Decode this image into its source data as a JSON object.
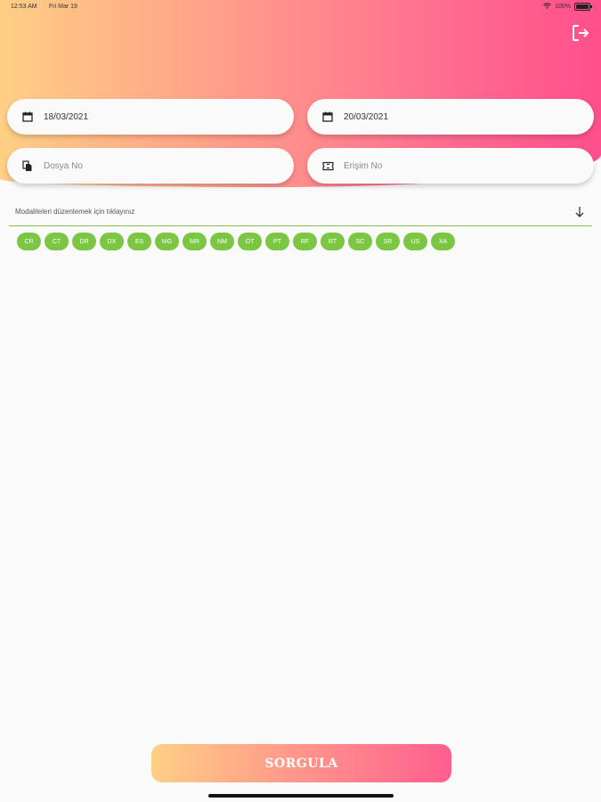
{
  "status_bar": {
    "time": "12:53 AM",
    "date": "Fri Mar 19",
    "battery": "100%"
  },
  "form": {
    "start_date": "18/03/2021",
    "end_date": "20/03/2021",
    "dosya_placeholder": "Dosya No",
    "erisim_placeholder": "Erişim No"
  },
  "modality_select": {
    "label": "Modaliteleri düzenlemek için tıklayınız"
  },
  "modalities": [
    "CR",
    "CT",
    "DR",
    "DX",
    "ES",
    "MG",
    "MR",
    "NM",
    "OT",
    "PT",
    "RF",
    "RT",
    "SC",
    "SR",
    "US",
    "XA"
  ],
  "actions": {
    "query_label": "SORGULA"
  },
  "colors": {
    "accent_green": "#7bc744",
    "gradient_start": "#ffcf85",
    "gradient_end": "#ff4f8c"
  }
}
